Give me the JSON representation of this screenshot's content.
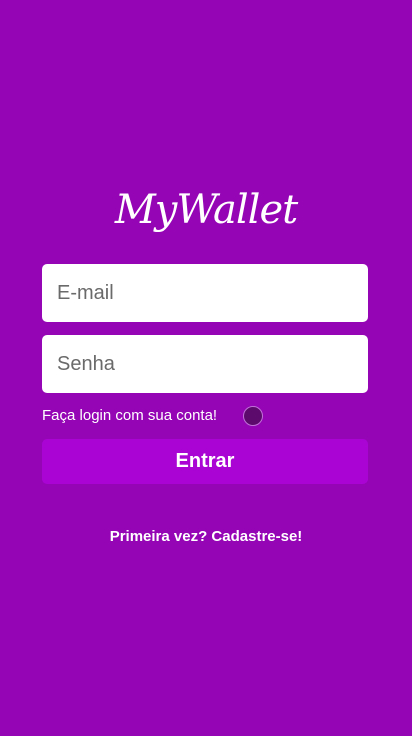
{
  "app": {
    "logo": "MyWallet"
  },
  "login_form": {
    "email_placeholder": "E-mail",
    "password_placeholder": "Senha",
    "hint": "Faça login com sua conta!",
    "submit_label": "Entrar"
  },
  "signup": {
    "link_label": "Primeira vez? Cadastre-se!"
  },
  "colors": {
    "background": "#9504b5",
    "button": "#a904d3",
    "toggle": "#5c0a6c"
  }
}
